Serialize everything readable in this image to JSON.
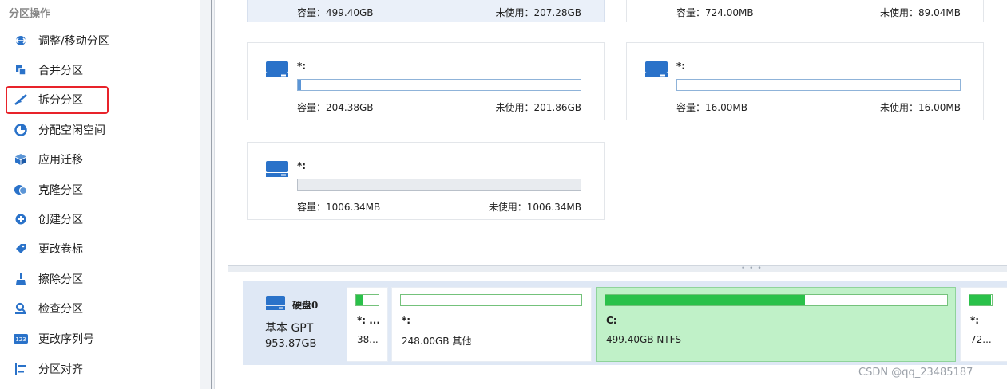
{
  "sidebar": {
    "title": "分区操作",
    "items": [
      {
        "label": "调整/移动分区",
        "icon": "resize-icon"
      },
      {
        "label": "合并分区",
        "icon": "merge-icon"
      },
      {
        "label": "拆分分区",
        "icon": "split-icon"
      },
      {
        "label": "分配空闲空间",
        "icon": "allocate-icon"
      },
      {
        "label": "应用迁移",
        "icon": "app-migrate-icon"
      },
      {
        "label": "克隆分区",
        "icon": "clone-icon"
      },
      {
        "label": "创建分区",
        "icon": "create-icon"
      },
      {
        "label": "更改卷标",
        "icon": "label-icon"
      },
      {
        "label": "擦除分区",
        "icon": "wipe-icon"
      },
      {
        "label": "检查分区",
        "icon": "check-icon"
      },
      {
        "label": "更改序列号",
        "icon": "serial-icon"
      },
      {
        "label": "分区对齐",
        "icon": "align-icon"
      }
    ],
    "highlighted_index": 2
  },
  "cards": [
    {
      "name": "",
      "capacity": "容量：499.40GB",
      "unused": "未使用：207.28GB",
      "selected": true
    },
    {
      "name": "",
      "capacity": "容量：724.00MB",
      "unused": "未使用：89.04MB",
      "selected": false
    },
    {
      "name": "*:",
      "capacity": "容量：204.38GB",
      "unused": "未使用：201.86GB",
      "used_fraction": 0.012,
      "bar": "normal"
    },
    {
      "name": "*:",
      "capacity": "容量：16.00MB",
      "unused": "未使用：16.00MB",
      "used_fraction": 0,
      "bar": "normal"
    },
    {
      "name": "*:",
      "capacity": "容量：1006.34MB",
      "unused": "未使用：1006.34MB",
      "used_fraction": 0,
      "bar": "gray"
    }
  ],
  "disk": {
    "name": "硬盘0",
    "type": "基本 GPT",
    "size": "953.87GB"
  },
  "partitions": [
    {
      "label": "*: ...",
      "info": "38...",
      "used_fraction": 0.3
    },
    {
      "label": "*:",
      "info": "248.00GB 其他",
      "used_fraction": 0
    },
    {
      "label": "C:",
      "info": "499.40GB NTFS",
      "used_fraction": 0.585,
      "selected": true
    },
    {
      "label": "*:",
      "info": "72...",
      "used_fraction": 0.95
    }
  ],
  "watermark": "CSDN @qq_23485187",
  "colors": {
    "accent": "#2a72c9",
    "highlight": "#e8232a",
    "partition_used": "#2ac14a",
    "selected_partition": "#c0f1c8"
  }
}
